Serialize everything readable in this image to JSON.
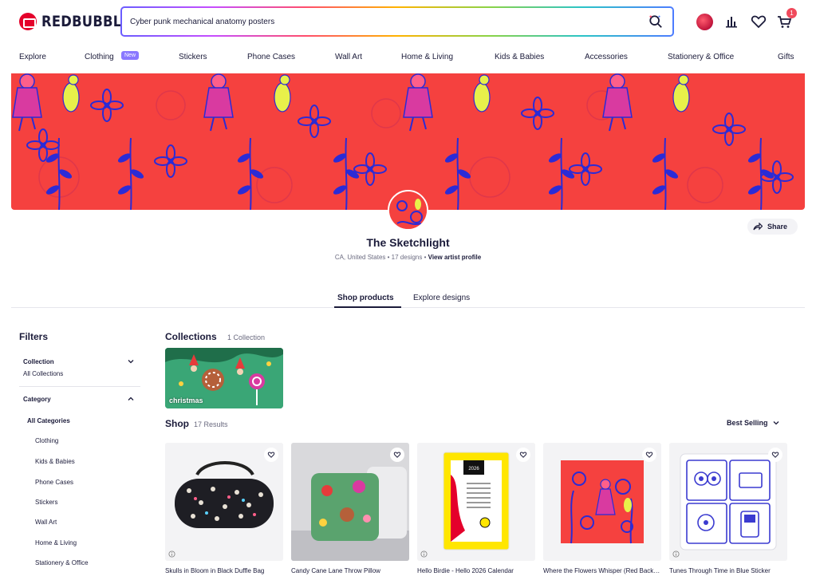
{
  "header": {
    "logo_text": "REDBUBBLE",
    "search_value": "Cyber punk mechanical anatomy posters",
    "cart_count": "1",
    "icons": [
      "search-icon",
      "avatar",
      "chart-icon",
      "heart-icon",
      "cart-icon"
    ]
  },
  "nav": {
    "items": [
      "Explore",
      "Clothing",
      "Stickers",
      "Phone Cases",
      "Wall Art",
      "Home & Living",
      "Kids & Babies",
      "Accessories",
      "Stationery & Office",
      "Gifts"
    ],
    "new_badge": "New"
  },
  "profile": {
    "shop_name": "The Sketchlight",
    "location": "CA, United States",
    "designs": "17 designs",
    "view_profile": "View artist profile",
    "share_label": "Share"
  },
  "tabs": [
    "Shop products",
    "Explore designs"
  ],
  "filters": {
    "title": "Filters",
    "collection_label": "Collection",
    "collection_value": "All Collections",
    "category_label": "Category",
    "categories": [
      "All Categories",
      "Clothing",
      "Kids & Babies",
      "Phone Cases",
      "Stickers",
      "Wall Art",
      "Home & Living",
      "Stationery & Office"
    ]
  },
  "collections": {
    "title": "Collections",
    "count": "1 Collection",
    "items": [
      {
        "label": "christmas"
      }
    ]
  },
  "shop": {
    "title": "Shop",
    "count": "17 Results",
    "sort_label": "Best Selling",
    "products": [
      {
        "title": "Skulls in Bloom in Black Duffle Bag"
      },
      {
        "title": "Candy Cane Lane Throw Pillow"
      },
      {
        "title": "Hello Birdie - Hello 2026 Calendar"
      },
      {
        "title": "Where the Flowers Whisper (Red Background)"
      },
      {
        "title": "Tunes Through Time in Blue Sticker"
      }
    ],
    "calendar_year": "2026"
  },
  "colors": {
    "brand": "#e4002b",
    "banner_bg": "#f5413f",
    "banner_ink": "#2b2bd6",
    "accent_badge": "#8a78ff"
  }
}
